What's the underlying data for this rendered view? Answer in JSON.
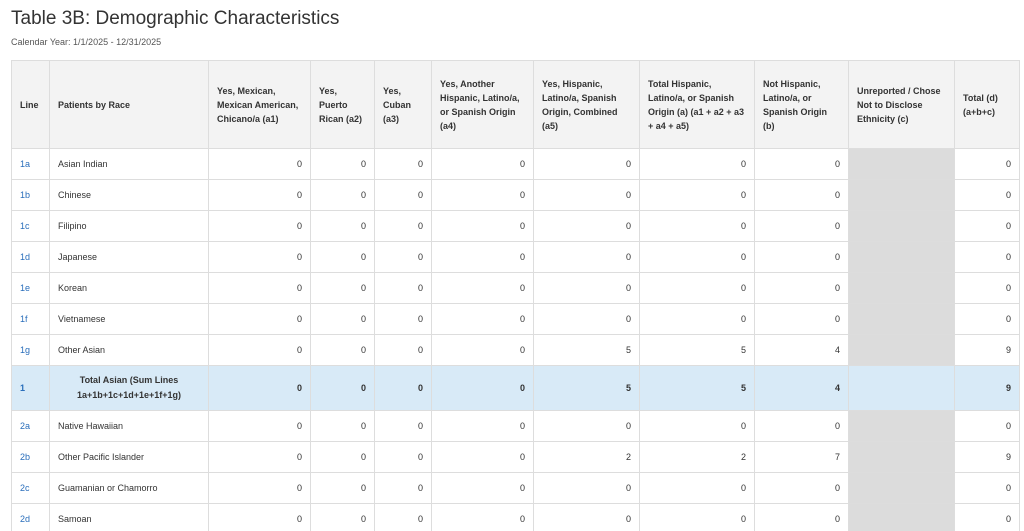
{
  "page": {
    "title": "Table 3B: Demographic Characteristics",
    "calendar_year": "Calendar Year: 1/1/2025 - 12/31/2025"
  },
  "table": {
    "headers": [
      "Line",
      "Patients by Race",
      "Yes, Mexican, Mexican American, Chicano/a (a1)",
      "Yes, Puerto Rican (a2)",
      "Yes, Cuban (a3)",
      "Yes, Another Hispanic, Latino/a, or Spanish Origin (a4)",
      "Yes, Hispanic, Latino/a, Spanish Origin, Combined (a5)",
      "Total Hispanic, Latino/a, or Spanish Origin (a) (a1 + a2 + a3 + a4 + a5)",
      "Not Hispanic, Latino/a, or Spanish Origin (b)",
      "Unreported / Chose Not to Disclose Ethnicity (c)",
      "Total (d) (a+b+c)"
    ],
    "rows": [
      {
        "line": "1a",
        "race": "Asian Indian",
        "a1": "0",
        "a2": "0",
        "a3": "0",
        "a4": "0",
        "a5": "0",
        "a": "0",
        "b": "0",
        "c": "",
        "d": "0"
      },
      {
        "line": "1b",
        "race": "Chinese",
        "a1": "0",
        "a2": "0",
        "a3": "0",
        "a4": "0",
        "a5": "0",
        "a": "0",
        "b": "0",
        "c": "",
        "d": "0"
      },
      {
        "line": "1c",
        "race": "Filipino",
        "a1": "0",
        "a2": "0",
        "a3": "0",
        "a4": "0",
        "a5": "0",
        "a": "0",
        "b": "0",
        "c": "",
        "d": "0"
      },
      {
        "line": "1d",
        "race": "Japanese",
        "a1": "0",
        "a2": "0",
        "a3": "0",
        "a4": "0",
        "a5": "0",
        "a": "0",
        "b": "0",
        "c": "",
        "d": "0"
      },
      {
        "line": "1e",
        "race": "Korean",
        "a1": "0",
        "a2": "0",
        "a3": "0",
        "a4": "0",
        "a5": "0",
        "a": "0",
        "b": "0",
        "c": "",
        "d": "0"
      },
      {
        "line": "1f",
        "race": "Vietnamese",
        "a1": "0",
        "a2": "0",
        "a3": "0",
        "a4": "0",
        "a5": "0",
        "a": "0",
        "b": "0",
        "c": "",
        "d": "0"
      },
      {
        "line": "1g",
        "race": "Other Asian",
        "a1": "0",
        "a2": "0",
        "a3": "0",
        "a4": "0",
        "a5": "5",
        "a": "5",
        "b": "4",
        "c": "",
        "d": "9"
      },
      {
        "line": "1",
        "race": "Total Asian (Sum Lines 1a+1b+1c+1d+1e+1f+1g)",
        "a1": "0",
        "a2": "0",
        "a3": "0",
        "a4": "0",
        "a5": "5",
        "a": "5",
        "b": "4",
        "c": "",
        "d": "9",
        "total": true
      },
      {
        "line": "2a",
        "race": "Native Hawaiian",
        "a1": "0",
        "a2": "0",
        "a3": "0",
        "a4": "0",
        "a5": "0",
        "a": "0",
        "b": "0",
        "c": "",
        "d": "0"
      },
      {
        "line": "2b",
        "race": "Other Pacific Islander",
        "a1": "0",
        "a2": "0",
        "a3": "0",
        "a4": "0",
        "a5": "2",
        "a": "2",
        "b": "7",
        "c": "",
        "d": "9"
      },
      {
        "line": "2c",
        "race": "Guamanian or Chamorro",
        "a1": "0",
        "a2": "0",
        "a3": "0",
        "a4": "0",
        "a5": "0",
        "a": "0",
        "b": "0",
        "c": "",
        "d": "0"
      },
      {
        "line": "2d",
        "race": "Samoan",
        "a1": "0",
        "a2": "0",
        "a3": "0",
        "a4": "0",
        "a5": "0",
        "a": "0",
        "b": "0",
        "c": "",
        "d": "0"
      }
    ]
  }
}
